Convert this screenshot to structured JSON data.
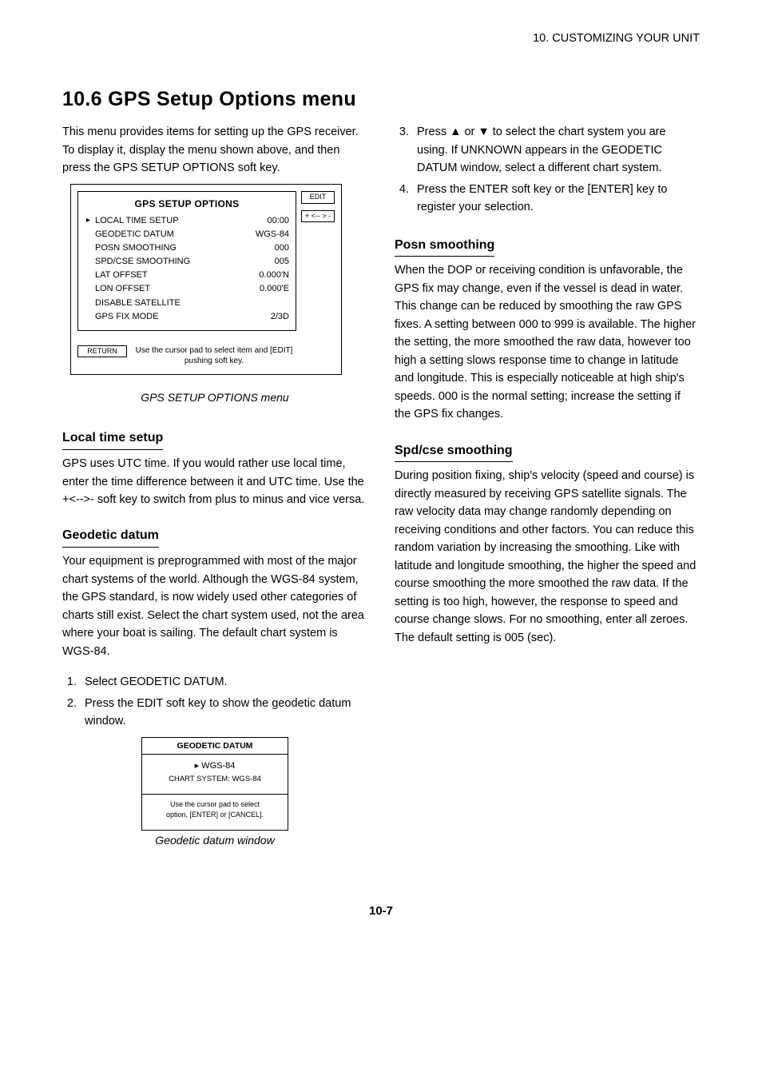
{
  "header": {
    "running_head": "10. CUSTOMIZING YOUR UNIT"
  },
  "section": {
    "number": "10.6",
    "title": "GPS Setup Options menu"
  },
  "left": {
    "intro": "This menu provides items for setting up the GPS receiver. To display it, display the menu shown above, and then press the GPS SETUP OPTIONS soft key.",
    "panel_title": "GPS SETUP OPTIONS",
    "rows": [
      {
        "arrow": "▸",
        "label": "LOCAL TIME SETUP",
        "value": "00:00"
      },
      {
        "arrow": "",
        "label": "GEODETIC DATUM",
        "value": "WGS-84"
      },
      {
        "arrow": "",
        "label": "POSN SMOOTHING",
        "value": "000"
      },
      {
        "arrow": "",
        "label": "SPD/CSE SMOOTHING",
        "value": "005"
      },
      {
        "arrow": "",
        "label": "LAT OFFSET",
        "value": "0.000'N"
      },
      {
        "arrow": "",
        "label": "LON OFFSET",
        "value": "0.000'E"
      },
      {
        "arrow": "",
        "label": "DISABLE SATELLITE",
        "value": ""
      },
      {
        "arrow": "",
        "label": "GPS FIX MODE",
        "value": "2/3D"
      }
    ],
    "softkeys": {
      "edit": "EDIT",
      "plusminus": "+ <-- > -",
      "return": "RETURN"
    },
    "hint": "Use the cursor pad to select item and [EDIT] pushing soft key.",
    "caption": "GPS SETUP OPTIONS menu",
    "local_time": {
      "heading": "Local time setup",
      "body": "GPS uses UTC time. If you would rather use local time, enter the time difference between it and UTC time. Use the +<-->- soft key to switch from plus to minus and vice versa."
    },
    "geodetic": {
      "heading": "Geodetic datum",
      "body": "Your equipment is preprogrammed with most of the major chart systems of the world. Although the WGS-84 system, the GPS standard, is now widely used other categories of charts still exist. Select the chart system used, not the area where your boat is sailing. The default chart system is WGS-84.",
      "steps": [
        "Select GEODETIC DATUM.",
        "Press the EDIT soft key to show the geodetic datum window."
      ],
      "window": {
        "title": "GEODETIC DATUM",
        "big": "▸ WGS-84",
        "line2": "CHART SYSTEM: WGS-84",
        "foot1": "Use the cursor pad to select",
        "foot2": "option, [ENTER] or [CANCEL]."
      },
      "caption2": "Geodetic datum window"
    }
  },
  "right": {
    "steps": [
      "Press ▲ or ▼ to select the chart system you are using. If UNKNOWN appears in the GEODETIC DATUM window, select a different chart system.",
      "Press the ENTER soft key or the [ENTER] key to register your selection."
    ],
    "posn": {
      "heading": "Posn smoothing",
      "body": "When the DOP or receiving condition is unfavorable, the GPS fix may change, even if the vessel is dead in water. This change can be reduced by smoothing the raw GPS fixes. A setting between 000 to 999 is available. The higher the setting, the more smoothed the raw data, however too high a setting slows response time to change in latitude and longitude. This is especially noticeable at high ship's speeds. 000 is the normal setting; increase the setting if the GPS fix changes."
    },
    "spd": {
      "heading": "Spd/cse smoothing",
      "body": "During position fixing, ship's velocity (speed and course) is directly measured by receiving GPS satellite signals. The raw velocity data may change randomly depending on receiving conditions and other factors. You can reduce this random variation by increasing the smoothing. Like with latitude and longitude smoothing, the higher the speed and course smoothing the more smoothed the raw data. If the setting is too high, however, the response to speed and course change slows. For no smoothing, enter all zeroes. The default setting is 005 (sec)."
    }
  },
  "page_number": "10-7"
}
